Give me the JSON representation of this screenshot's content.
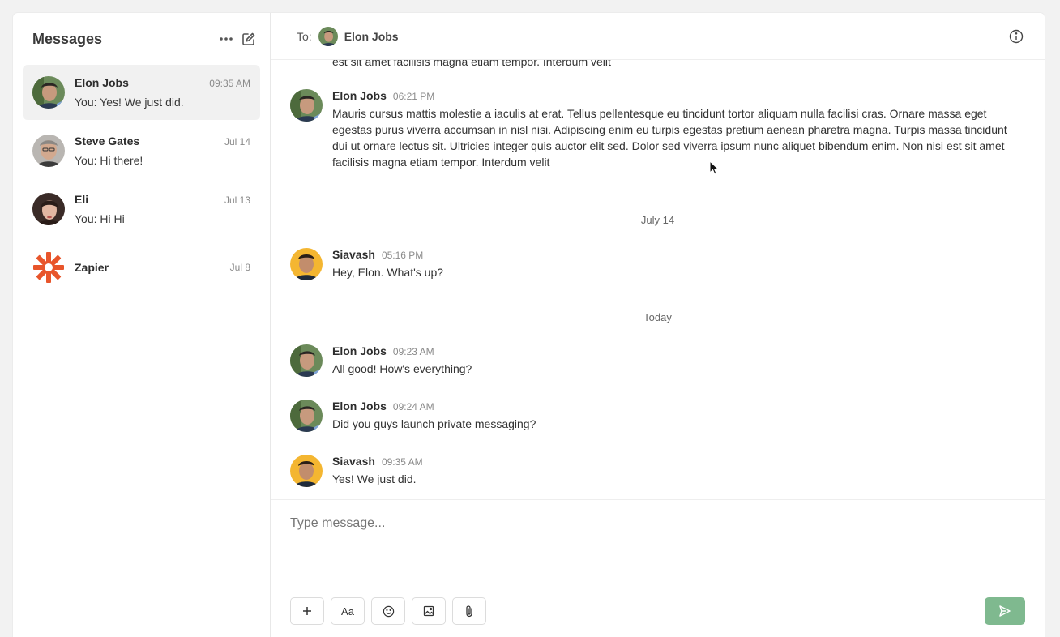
{
  "sidebar": {
    "title": "Messages",
    "conversations": [
      {
        "name": "Elon Jobs",
        "time": "09:35 AM",
        "preview": "You: Yes! We just did.",
        "active": true
      },
      {
        "name": "Steve Gates",
        "time": "Jul 14",
        "preview": "You: Hi there!"
      },
      {
        "name": "Eli",
        "time": "Jul 13",
        "preview": "You: Hi Hi"
      },
      {
        "name": "Zapier",
        "time": "Jul 8",
        "preview": ""
      }
    ]
  },
  "header": {
    "to_label": "To:",
    "recipient": "Elon Jobs"
  },
  "thread": {
    "cut_text": "est sit amet facilisis magna etiam tempor. Interdum velit",
    "messages": [
      {
        "author": "Elon Jobs",
        "time": "06:21 PM",
        "text": "Mauris cursus mattis molestie a iaculis at erat. Tellus pellentesque eu tincidunt tortor aliquam nulla facilisi cras. Ornare massa eget egestas purus viverra accumsan in nisl nisi. Adipiscing enim eu turpis egestas pretium aenean pharetra magna. Turpis massa tincidunt dui ut ornare lectus sit. Ultricies integer quis auctor elit sed. Dolor sed viverra ipsum nunc aliquet bibendum enim. Non nisi est sit amet facilisis magna etiam tempor. Interdum velit"
      },
      {
        "author": "Siavash",
        "time": "05:16 PM",
        "text": "Hey, Elon. What's up?"
      },
      {
        "author": "Elon Jobs",
        "time": "09:23 AM",
        "text": "All good! How's everything?"
      },
      {
        "author": "Elon Jobs",
        "time": "09:24 AM",
        "text": "Did you guys launch private messaging?"
      },
      {
        "author": "Siavash",
        "time": "09:35 AM",
        "text": "Yes! We just did."
      }
    ],
    "separators": [
      "July 14",
      "Today"
    ]
  },
  "composer": {
    "placeholder": "Type message...",
    "value": ""
  },
  "toolbar": {
    "add_icon": "plus-icon",
    "format_icon": "text-format-icon",
    "emoji_icon": "emoji-icon",
    "image_icon": "image-icon",
    "attach_icon": "paperclip-icon",
    "send_icon": "send-icon",
    "format_label": "Aa"
  },
  "colors": {
    "send_button": "#7fb98f",
    "zapier": "#e8552b",
    "active_row": "#f1f1f1"
  }
}
